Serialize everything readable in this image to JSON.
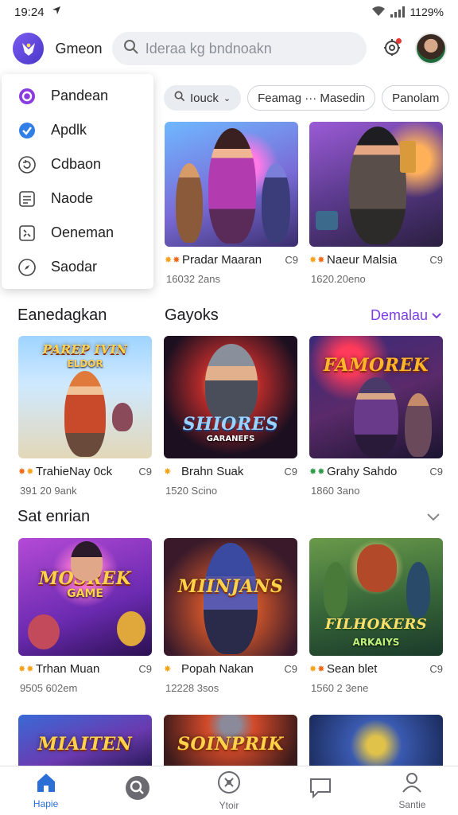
{
  "status_bar": {
    "time": "19:24",
    "battery": "1129%"
  },
  "header": {
    "app_name": "Gmeon",
    "search_placeholder": "Ideraa kg bndnoakn",
    "logo_icon": "app-logo-icon",
    "notification_icon": "gear-bell-icon"
  },
  "menu": {
    "items": [
      {
        "label": "Pandean",
        "icon": "circle-dot-icon"
      },
      {
        "label": "Apdlk",
        "icon": "check-circle-icon"
      },
      {
        "label": "Cdbaon",
        "icon": "refresh-icon"
      },
      {
        "label": "Naode",
        "icon": "document-icon"
      },
      {
        "label": "Oeneman",
        "icon": "expand-icon"
      },
      {
        "label": "Saodar",
        "icon": "compass-icon"
      }
    ]
  },
  "filters": [
    {
      "label": "Iouck",
      "active": true
    },
    {
      "label": "Feamag ··· Masedin",
      "active": false
    },
    {
      "label": "Panolam",
      "active": false
    }
  ],
  "sections": {
    "top": {
      "cards": [
        {
          "title": "Pradar Maaran",
          "sub": "16032 2ans",
          "badge": "C9"
        },
        {
          "title": "Naeur Malsia",
          "sub": "1620.20eno",
          "badge": "C9"
        }
      ]
    },
    "featured": {
      "label_left": "Eanedagkan",
      "label_right": "Gayoks",
      "see_more": "Demalau",
      "cards": [
        {
          "title": "TrahieNay 0ck",
          "sub": "391 20 9ank",
          "badge": "C9",
          "art_title": "PAREP IVIN",
          "art_sub": "ELDOR"
        },
        {
          "title": "Brahn Suak",
          "sub": "1520 Scino",
          "badge": "C9",
          "art_title": "SHIORES",
          "art_sub": "GARANEFS"
        },
        {
          "title": "Grahy Sahdo",
          "sub": "1860 3ano",
          "badge": "C9",
          "art_title": "FAMOREK",
          "art_sub": ""
        }
      ]
    },
    "second": {
      "label": "Sat enrian",
      "cards": [
        {
          "title": "Trhan Muan",
          "sub": "9505 602em",
          "badge": "C9",
          "art_title": "MOSREK",
          "art_sub": "GAME"
        },
        {
          "title": "Popah Nakan",
          "sub": "12228 3sos",
          "badge": "C9",
          "art_title": "MIINJANS",
          "art_sub": ""
        },
        {
          "title": "Sean blet",
          "sub": "1560 2 3ene",
          "badge": "C9",
          "art_title": "FILHOKERS",
          "art_sub": "ARKAIYS"
        }
      ]
    },
    "third": {
      "cards": [
        {
          "art_title": "MIAITEN"
        },
        {
          "art_title": "SOINPRIK"
        },
        {
          "art_title": ""
        }
      ]
    }
  },
  "bottom_nav": [
    {
      "label": "Hapie",
      "icon": "home-icon",
      "active": true
    },
    {
      "label": "",
      "icon": "search-icon",
      "active": false
    },
    {
      "label": "Ytoir",
      "icon": "compass-icon",
      "active": false
    },
    {
      "label": "",
      "icon": "chat-icon",
      "active": false
    },
    {
      "label": "Santie",
      "icon": "profile-icon",
      "active": false
    }
  ],
  "colors": {
    "accent": "#7b3fe4",
    "nav_active": "#2b6fd6"
  }
}
